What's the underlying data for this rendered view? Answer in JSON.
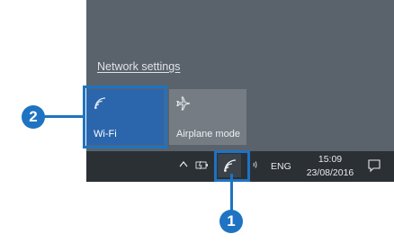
{
  "flyout": {
    "network_settings_link": "Network settings",
    "tiles": [
      {
        "label": "Wi-Fi",
        "icon": "wifi-icon",
        "state": "on"
      },
      {
        "label": "Airplane mode",
        "icon": "airplane-icon",
        "state": "off"
      }
    ]
  },
  "taskbar": {
    "icons": [
      "chevron-up-icon",
      "battery-icon",
      "wifi-icon",
      "volume-icon",
      "notification-icon"
    ],
    "language": "ENG",
    "time": "15:09",
    "date": "23/08/2016"
  },
  "callouts": [
    {
      "number": "1"
    },
    {
      "number": "2"
    }
  ],
  "colors": {
    "accent": "#2b66ad",
    "callout": "#1e73c2",
    "taskbar": "#2b3035",
    "flyout": "#5a626b"
  }
}
